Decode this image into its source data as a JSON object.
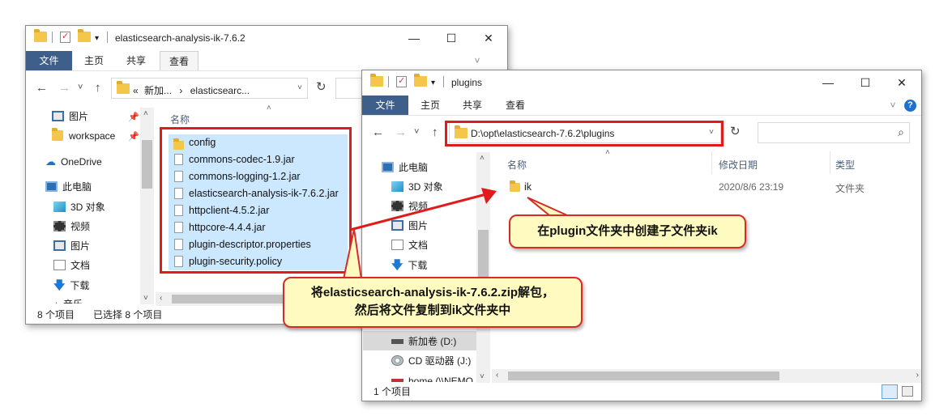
{
  "left_window": {
    "title": "elasticsearch-analysis-ik-7.6.2",
    "ribbon_tabs": [
      "文件",
      "主页",
      "共享",
      "查看"
    ],
    "address_crumbs": [
      "«",
      "新加...",
      "›",
      "elasticsearc..."
    ],
    "quick_access": [
      "图片",
      "workspace"
    ],
    "nav_tree": [
      "OneDrive",
      "此电脑",
      "3D 对象",
      "视频",
      "图片",
      "文档",
      "下载",
      "音乐"
    ],
    "column_name": "名称",
    "files": [
      "config",
      "commons-codec-1.9.jar",
      "commons-logging-1.2.jar",
      "elasticsearch-analysis-ik-7.6.2.jar",
      "httpclient-4.5.2.jar",
      "httpcore-4.4.4.jar",
      "plugin-descriptor.properties",
      "plugin-security.policy"
    ],
    "status_items": "8 个项目",
    "status_selected": "已选择 8 个项目"
  },
  "right_window": {
    "title": "plugins",
    "ribbon_tabs": [
      "文件",
      "主页",
      "共享",
      "查看"
    ],
    "address_path": "D:\\opt\\elasticsearch-7.6.2\\plugins",
    "nav_tree": [
      "此电脑",
      "3D 对象",
      "视频",
      "图片",
      "文档",
      "下载",
      "新加卷 (D:)",
      "CD 驱动器 (J:)",
      "home (\\\\NEMO"
    ],
    "columns": [
      "名称",
      "修改日期",
      "类型"
    ],
    "files": [
      {
        "name": "ik",
        "modified": "2020/8/6 23:19",
        "type": "文件夹"
      }
    ],
    "status_items": "1 个项目"
  },
  "callouts": {
    "plugin": "在plugin文件夹中创建子文件夹ik",
    "unzip_line1": "将elasticsearch-analysis-ik-7.6.2.zip解包，",
    "unzip_line2": "然后将文件复制到ik文件夹中"
  },
  "icons": {
    "back": "←",
    "forward": "→",
    "recent": "˅",
    "up": "↑",
    "refresh": "↻",
    "search": "⌕",
    "minimize": "—",
    "maximize": "☐",
    "close": "✕",
    "help": "?",
    "expand": "˅"
  },
  "colors": {
    "accent_red": "#e11b1b",
    "selection": "#cce8ff",
    "callout_bg": "#fffbc0",
    "file_tab": "#3e5f8a"
  }
}
